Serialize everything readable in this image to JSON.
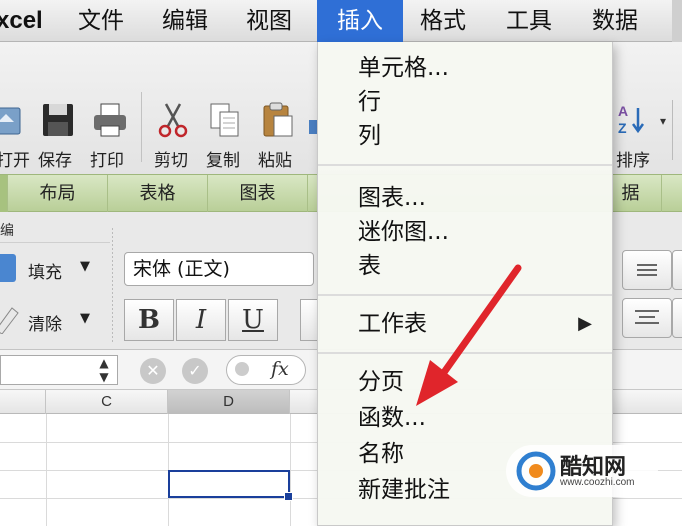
{
  "menubar": {
    "app": "xcel",
    "items": [
      "文件",
      "编辑",
      "视图",
      "插入",
      "格式",
      "工具",
      "数据"
    ]
  },
  "toolbar": {
    "labels": [
      "打开",
      "保存",
      "打印",
      "剪切",
      "复制",
      "粘贴",
      "排序"
    ]
  },
  "ribbon_tabs": [
    "布局",
    "表格",
    "图表",
    "据"
  ],
  "ribbon": {
    "group_title": "编",
    "fill_label": "填充",
    "clear_label": "清除",
    "font_name": "宋体 (正文)",
    "bold": "B",
    "italic": "I",
    "underline": "U"
  },
  "formula_bar": {
    "fx": "fx"
  },
  "columns": [
    "C",
    "D"
  ],
  "dropdown": {
    "items": [
      "单元格...",
      "行",
      "列",
      "图表...",
      "迷你图...",
      "表",
      "工作表",
      "分页",
      "函数...",
      "名称",
      "新建批注"
    ]
  },
  "watermark": {
    "brand": "酷知网",
    "url": "www.coozhi.com"
  },
  "colors": {
    "menu_active": "#2f6fd6",
    "ribbon_tab": "#c6d9a8",
    "annotation_arrow": "#e0252b",
    "selection": "#1a3f9b"
  }
}
